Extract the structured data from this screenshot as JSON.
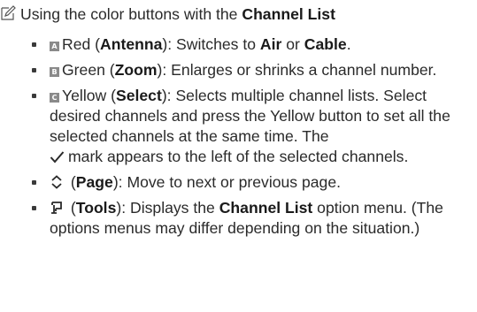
{
  "heading": {
    "pre": "Using the color buttons with the ",
    "bold": "Channel List"
  },
  "items": {
    "red": {
      "key_icon": "a-button-icon",
      "key_letter": "A",
      "color": "Red",
      "open": " (",
      "key": "Antenna",
      "close": "): Switches to ",
      "opt1": "Air",
      "or": " or ",
      "opt2": "Cable",
      "end": "."
    },
    "green": {
      "key_icon": "b-button-icon",
      "key_letter": "B",
      "color": "Green",
      "open": " (",
      "key": "Zoom",
      "close": "): Enlarges or shrinks a channel number."
    },
    "yellow": {
      "key_icon": "c-button-icon",
      "key_letter": "C",
      "color": "Yellow",
      "open": " (",
      "key": "Select",
      "close": "): Selects multiple channel lists. Select desired channels and press the Yellow button to set all the selected channels at the same time. The ",
      "check_icon": "checkmark-icon",
      "after": "mark appears to the left of the selected channels."
    },
    "page": {
      "icon": "up-down-arrow-icon",
      "open": " (",
      "key": "Page",
      "close": "): Move to next or previous page."
    },
    "tools": {
      "icon": "tools-icon",
      "open": " (",
      "key": "Tools",
      "mid": "): Displays the ",
      "bold": "Channel List",
      "end": " option menu. (The options menus may differ depending on the situation.)"
    }
  }
}
